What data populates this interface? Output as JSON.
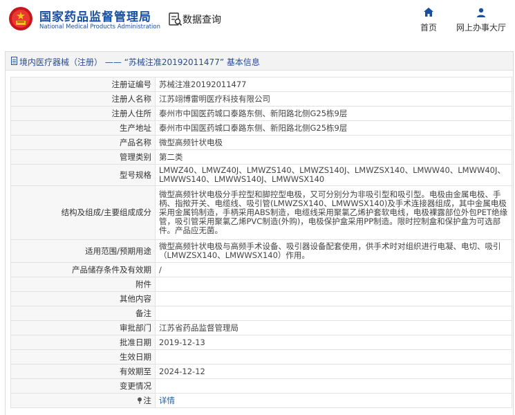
{
  "header": {
    "brand_cn": "国家药品监督管理局",
    "brand_en": "National Medical Products Administration",
    "query_label": "数据查询",
    "nav": [
      {
        "label": "首页",
        "icon": "home-icon"
      },
      {
        "label": "网上办事大厅",
        "icon": "user-icon"
      }
    ]
  },
  "panel": {
    "title": "境内医疗器械（注册） —— “苏械注准20192011477” 基本信息",
    "rows": [
      {
        "label": "注册证编号",
        "value": "苏械注准20192011477"
      },
      {
        "label": "注册人名称",
        "value": "江苏翊博雷明医疗科技有限公司"
      },
      {
        "label": "注册人住所",
        "value": "泰州市中国医药城口泰路东侧、新阳路北侧G25栋9层"
      },
      {
        "label": "生产地址",
        "value": "泰州市中国医药城口泰路东侧、新阳路北侧G25栋9层"
      },
      {
        "label": "产品名称",
        "value": "微型高频针状电极"
      },
      {
        "label": "管理类别",
        "value": "第二类"
      },
      {
        "label": "型号规格",
        "value": "LMWZ40、LMWZ40J、LMWZS140、LMWZS140J、LMWZSX140、LMWW40、LMWW40J、LMWWS140、LMWWS140J、LMWWSX140"
      },
      {
        "label": "结构及组成/主要组成成分",
        "value": "微型高频针状电极分手控型和脚控型电极，又可分别分为非吸引型和吸引型。电极由金属电极、手柄、指揿开关、电缆线、吸引管(LMWZSX140、LMWWSX140)及手术连接器组成，其中金属电极采用金属钨制造，手柄采用ABS制造，电缆线采用聚氯乙烯护套软电线，电极裸露部位外包PET绝缘管，吸引管采用聚氯乙烯PVC制造(外购)，电极保护盒采用PP制造。限时控制盒和保护盒为可选部件。产品应无菌。"
      },
      {
        "label": "适用范围/预期用途",
        "value": "微型高频针状电极与高频手术设备、吸引器设备配套使用，供手术时对组织进行电凝、电切、吸引（LMWZSX140、LMWWSX140）作用。"
      },
      {
        "label": "产品储存条件及有效期",
        "value": "/"
      },
      {
        "label": "附件",
        "value": ""
      },
      {
        "label": "其他内容",
        "value": ""
      },
      {
        "label": "备注",
        "value": ""
      },
      {
        "label": "审批部门",
        "value": "江苏省药品监督管理局"
      },
      {
        "label": "批准日期",
        "value": "2019-12-13"
      },
      {
        "label": "生效日期",
        "value": ""
      },
      {
        "label": "有效期至",
        "value": "2024-12-12"
      },
      {
        "label": "变更情况",
        "value": ""
      },
      {
        "label": "注",
        "value": "详情"
      }
    ]
  },
  "colors": {
    "brand_blue": "#1a4fa0",
    "emblem_red": "#c8161d",
    "link_blue": "#1a5fb4"
  }
}
